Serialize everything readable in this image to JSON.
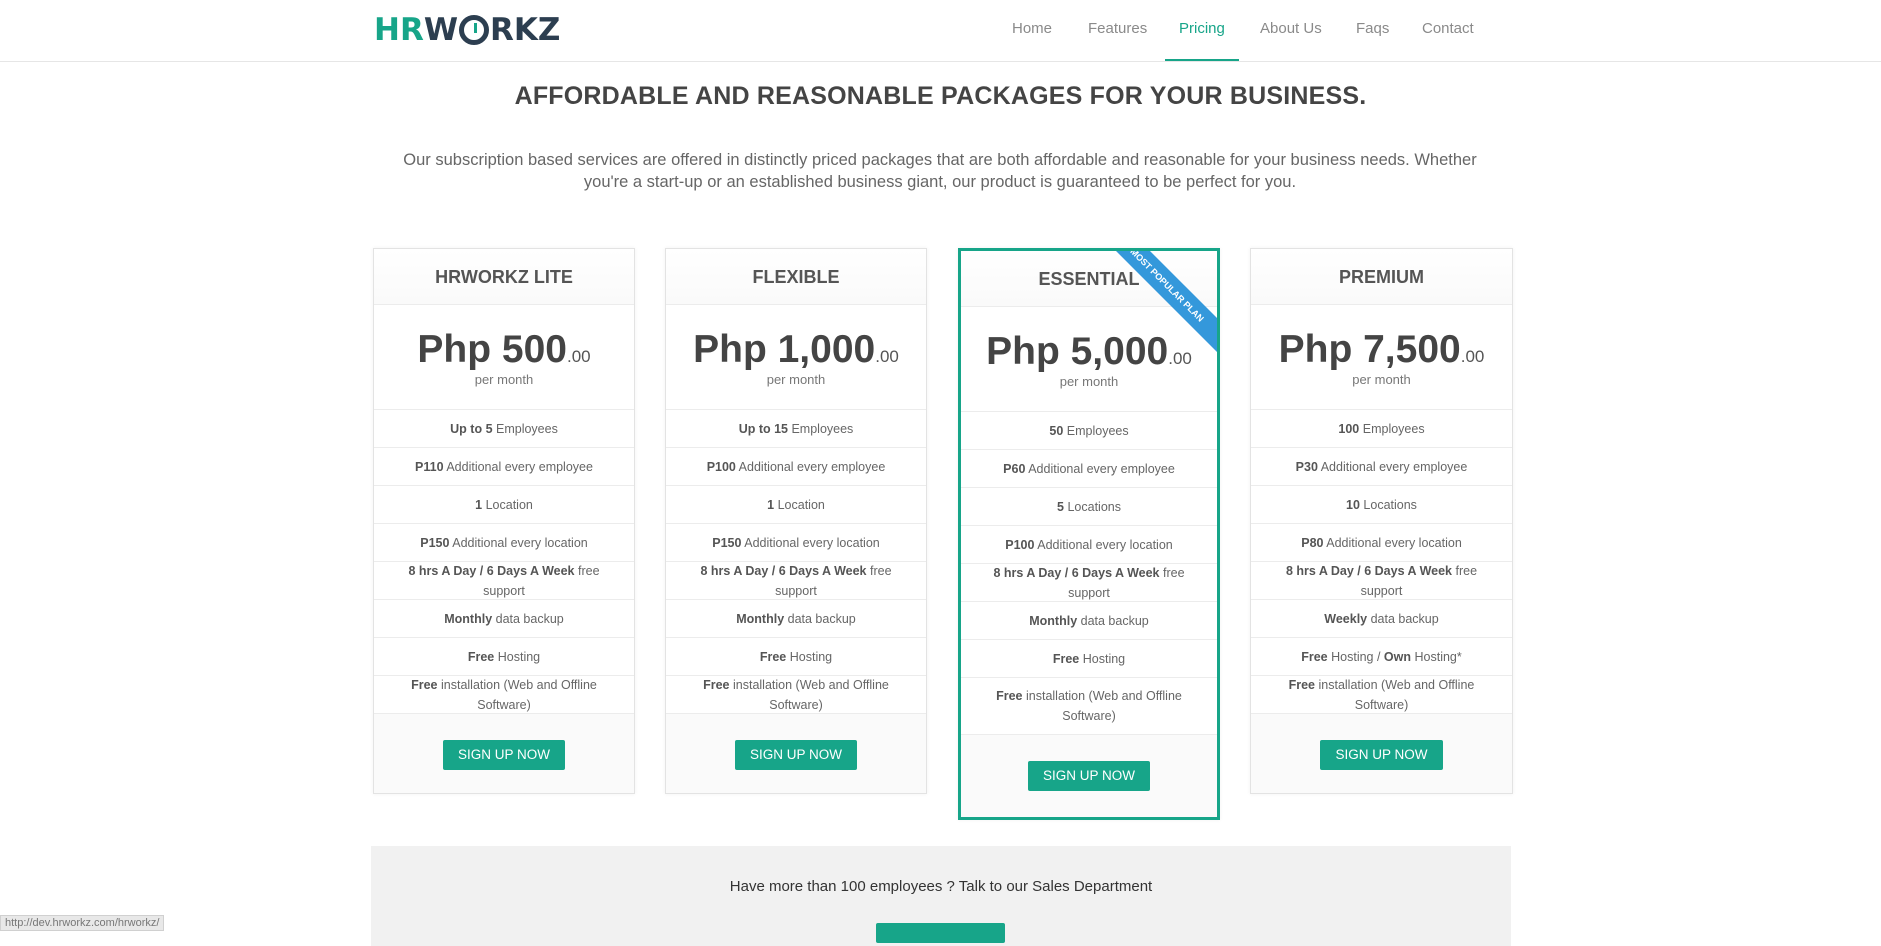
{
  "logo": {
    "hr": "HR",
    "w": "W",
    "rkz": "RKZ"
  },
  "nav": [
    {
      "label": "Home"
    },
    {
      "label": "Features"
    },
    {
      "label": "Pricing"
    },
    {
      "label": "About Us"
    },
    {
      "label": "Faqs"
    },
    {
      "label": "Contact"
    }
  ],
  "headline": "AFFORDABLE AND REASONABLE PACKAGES FOR YOUR BUSINESS.",
  "intro": "Our subscription based services are offered in distinctly priced packages that are both affordable and reasonable for your business needs. Whether you're a start-up or an established business giant, our product is guaranteed to be perfect for you.",
  "plans": [
    {
      "name": "HRWORKZ LITE",
      "price": "Php 500",
      "cents": ".00",
      "period": "per month",
      "features": [
        [
          "Up to 5",
          " Employees"
        ],
        [
          "P110",
          " Additional every employee"
        ],
        [
          "1",
          " Location"
        ],
        [
          "P150",
          " Additional every location"
        ],
        [
          "8 hrs A Day / 6 Days A Week",
          " free support"
        ],
        [
          "Monthly",
          " data backup"
        ],
        [
          "Free",
          " Hosting"
        ],
        [
          "Free",
          " installation (Web and Offline Software)"
        ]
      ],
      "cta": "SIGN UP NOW"
    },
    {
      "name": "FLEXIBLE",
      "price": "Php 1,000",
      "cents": ".00",
      "period": "per month",
      "features": [
        [
          "Up to 15",
          " Employees"
        ],
        [
          "P100",
          " Additional every employee"
        ],
        [
          "1",
          " Location"
        ],
        [
          "P150",
          " Additional every location"
        ],
        [
          "8 hrs A Day / 6 Days A Week",
          " free support"
        ],
        [
          "Monthly",
          " data backup"
        ],
        [
          "Free",
          " Hosting"
        ],
        [
          "Free",
          " installation (Web and Offline Software)"
        ]
      ],
      "cta": "SIGN UP NOW"
    },
    {
      "name": "ESSENTIAL",
      "price": "Php 5,000",
      "cents": ".00",
      "period": "per month",
      "ribbon": "MOST POPULAR PLAN",
      "features": [
        [
          "50",
          " Employees"
        ],
        [
          "P60",
          " Additional every employee"
        ],
        [
          "5",
          " Locations"
        ],
        [
          "P100",
          " Additional every location"
        ],
        [
          "8 hrs A Day / 6 Days A Week",
          " free support"
        ],
        [
          "Monthly",
          " data backup"
        ],
        [
          "Free",
          " Hosting"
        ],
        [
          "Free",
          " installation (Web and Offline Software)"
        ]
      ],
      "cta": "SIGN UP NOW"
    },
    {
      "name": "PREMIUM",
      "price": "Php 7,500",
      "cents": ".00",
      "period": "per month",
      "features": [
        [
          "100",
          " Employees"
        ],
        [
          "P30",
          " Additional every employee"
        ],
        [
          "10",
          " Locations"
        ],
        [
          "P80",
          " Additional every location"
        ],
        [
          "8 hrs A Day / 6 Days A Week",
          " free support"
        ],
        [
          "Weekly",
          " data backup"
        ],
        [
          "Free",
          " Hosting / ",
          "Own",
          " Hosting*"
        ],
        [
          "Free",
          " installation (Web and Offline Software)"
        ]
      ],
      "cta": "SIGN UP NOW"
    }
  ],
  "band": {
    "text": "Have more than 100 employees ? Talk to our Sales Department"
  },
  "statusbar": "http://dev.hrworkz.com/hrworkz/",
  "colors": {
    "accent": "#17a589",
    "ribbon": "#3498db",
    "dark": "#2c3e50"
  }
}
